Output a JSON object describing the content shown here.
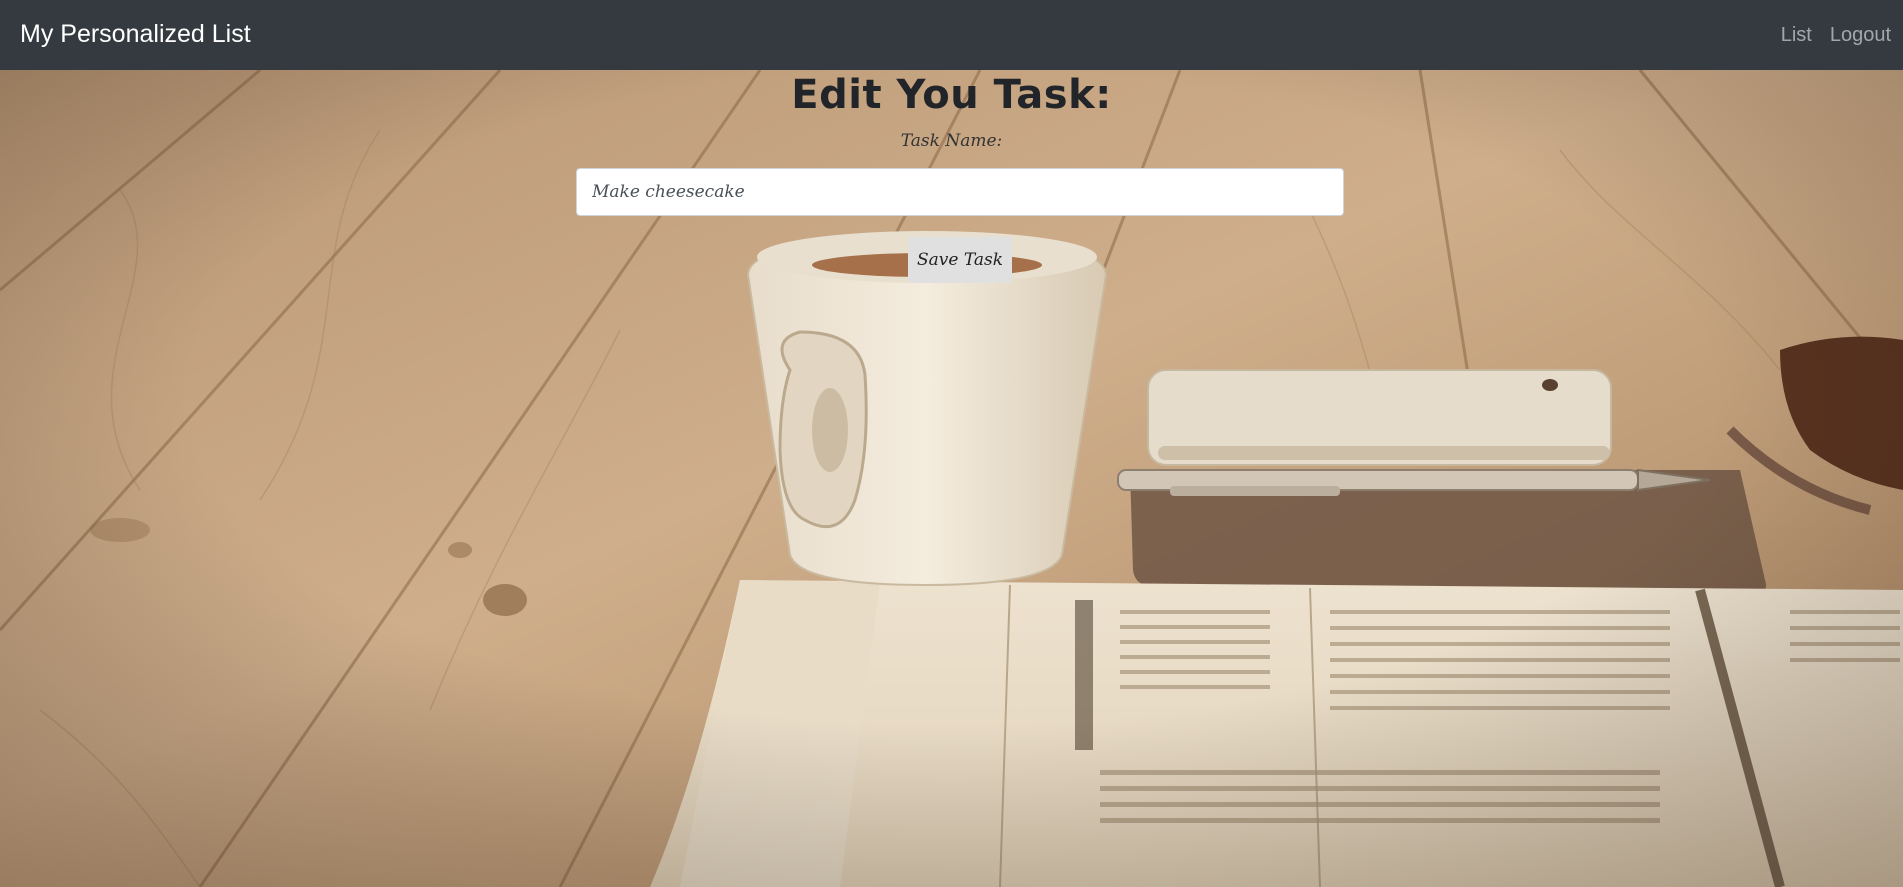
{
  "navbar": {
    "brand": "My Personalized List",
    "links": [
      {
        "label": "List"
      },
      {
        "label": "Logout"
      }
    ]
  },
  "form": {
    "heading": "Edit You Task:",
    "task_name_label": "Task Name:",
    "task_name_value": "Make cheesecake",
    "save_label": "Save Task"
  },
  "colors": {
    "navbar_bg": "#343a40",
    "brand_text": "#ffffff",
    "nav_link_text": "#9a9da0",
    "heading_text": "#212529",
    "button_bg": "#e0e0e0"
  },
  "background": {
    "description_icons": [
      "wood-table-photo",
      "coffee-cup",
      "smartphone",
      "pen",
      "newspaper",
      "sunglasses"
    ]
  }
}
